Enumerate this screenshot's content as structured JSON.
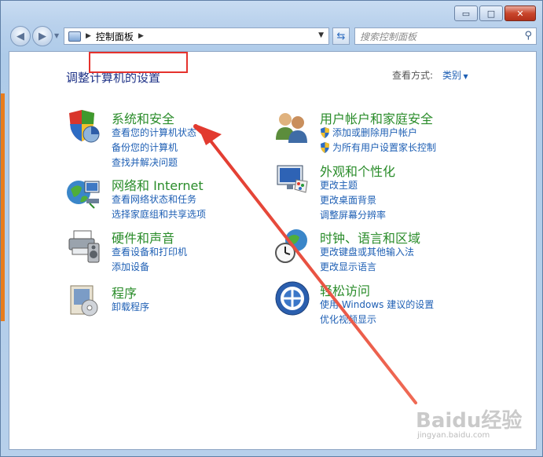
{
  "window": {
    "caption": {
      "minimize": "▭",
      "maximize": "□",
      "close": "✕"
    }
  },
  "nav": {
    "breadcrumb": "控制面板",
    "search_placeholder": "搜索控制面板"
  },
  "content": {
    "title": "调整计算机的设置",
    "view_by_label": "查看方式:",
    "view_by_value": "类别"
  },
  "categories_left": [
    {
      "title": "系统和安全",
      "icon": "shield-pie-icon",
      "links": [
        "查看您的计算机状态",
        "备份您的计算机",
        "查找并解决问题"
      ]
    },
    {
      "title": "网络和 Internet",
      "icon": "network-globe-icon",
      "links": [
        "查看网络状态和任务",
        "选择家庭组和共享选项"
      ]
    },
    {
      "title": "硬件和声音",
      "icon": "printer-speaker-icon",
      "links": [
        "查看设备和打印机",
        "添加设备"
      ]
    },
    {
      "title": "程序",
      "icon": "programs-box-icon",
      "links": [
        "卸载程序"
      ]
    }
  ],
  "categories_right": [
    {
      "title": "用户帐户和家庭安全",
      "icon": "users-icon",
      "links": [
        "添加或删除用户帐户",
        "为所有用户设置家长控制"
      ]
    },
    {
      "title": "外观和个性化",
      "icon": "monitor-palette-icon",
      "links": [
        "更改主题",
        "更改桌面背景",
        "调整屏幕分辨率"
      ]
    },
    {
      "title": "时钟、语言和区域",
      "icon": "clock-globe-icon",
      "links": [
        "更改键盘或其他输入法",
        "更改显示语言"
      ]
    },
    {
      "title": "轻松访问",
      "icon": "ease-of-access-icon",
      "links": [
        "使用 Windows 建议的设置",
        "优化视频显示"
      ]
    }
  ],
  "watermark": {
    "main": "Baidu经验",
    "sub": "jingyan.baidu.com"
  },
  "colors": {
    "annotation": "#e5322d",
    "category_title": "#2a8c2a",
    "link": "#1e5fb4"
  }
}
